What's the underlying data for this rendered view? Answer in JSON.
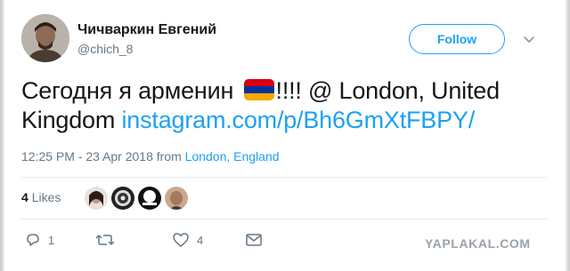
{
  "author": {
    "display_name": "Чичваркин Евгений",
    "handle": "@chich_8"
  },
  "follow_label": "Follow",
  "tweet": {
    "text_before_flag": "Сегодня я арменин",
    "text_after_flag": "!!!! @ London, United Kingdom",
    "link": "instagram.com/p/Bh6GmXtFBPY/",
    "flag_colors": [
      "#d90012",
      "#0033a0",
      "#f2a800"
    ]
  },
  "timestamp": {
    "time": "12:25 PM - 23 Apr 2018",
    "from": "from",
    "location": "London, England"
  },
  "likes": {
    "count": "4",
    "label": "Likes"
  },
  "actions": {
    "reply_count": "1",
    "retweet_count": "",
    "like_count": "4"
  },
  "watermark": "YAPLAKAL.COM",
  "colors": {
    "accent": "#1da1f2",
    "muted": "#657786",
    "text": "#14171a"
  }
}
